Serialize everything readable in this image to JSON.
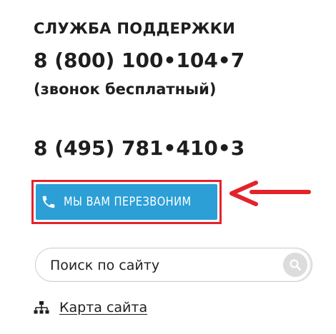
{
  "support": {
    "title": "СЛУЖБА ПОДДЕРЖКИ",
    "phone_free": "8 (800) 100•104•7",
    "phone_free_note": "(звонок бесплатный)",
    "phone_moscow": "8 (495) 781•410•3"
  },
  "callback": {
    "label": "МЫ ВАМ ПЕРЕЗВОНИМ",
    "icon": "phone-icon",
    "button_color": "#2b9fd6",
    "highlight_color": "#e3232a"
  },
  "annotation": {
    "icon": "red-arrow-icon",
    "color": "#e3232a"
  },
  "search": {
    "placeholder": "Поиск по сайту",
    "value": "",
    "icon": "search-icon"
  },
  "sitemap": {
    "label": "Карта сайта",
    "icon": "sitemap-icon"
  }
}
